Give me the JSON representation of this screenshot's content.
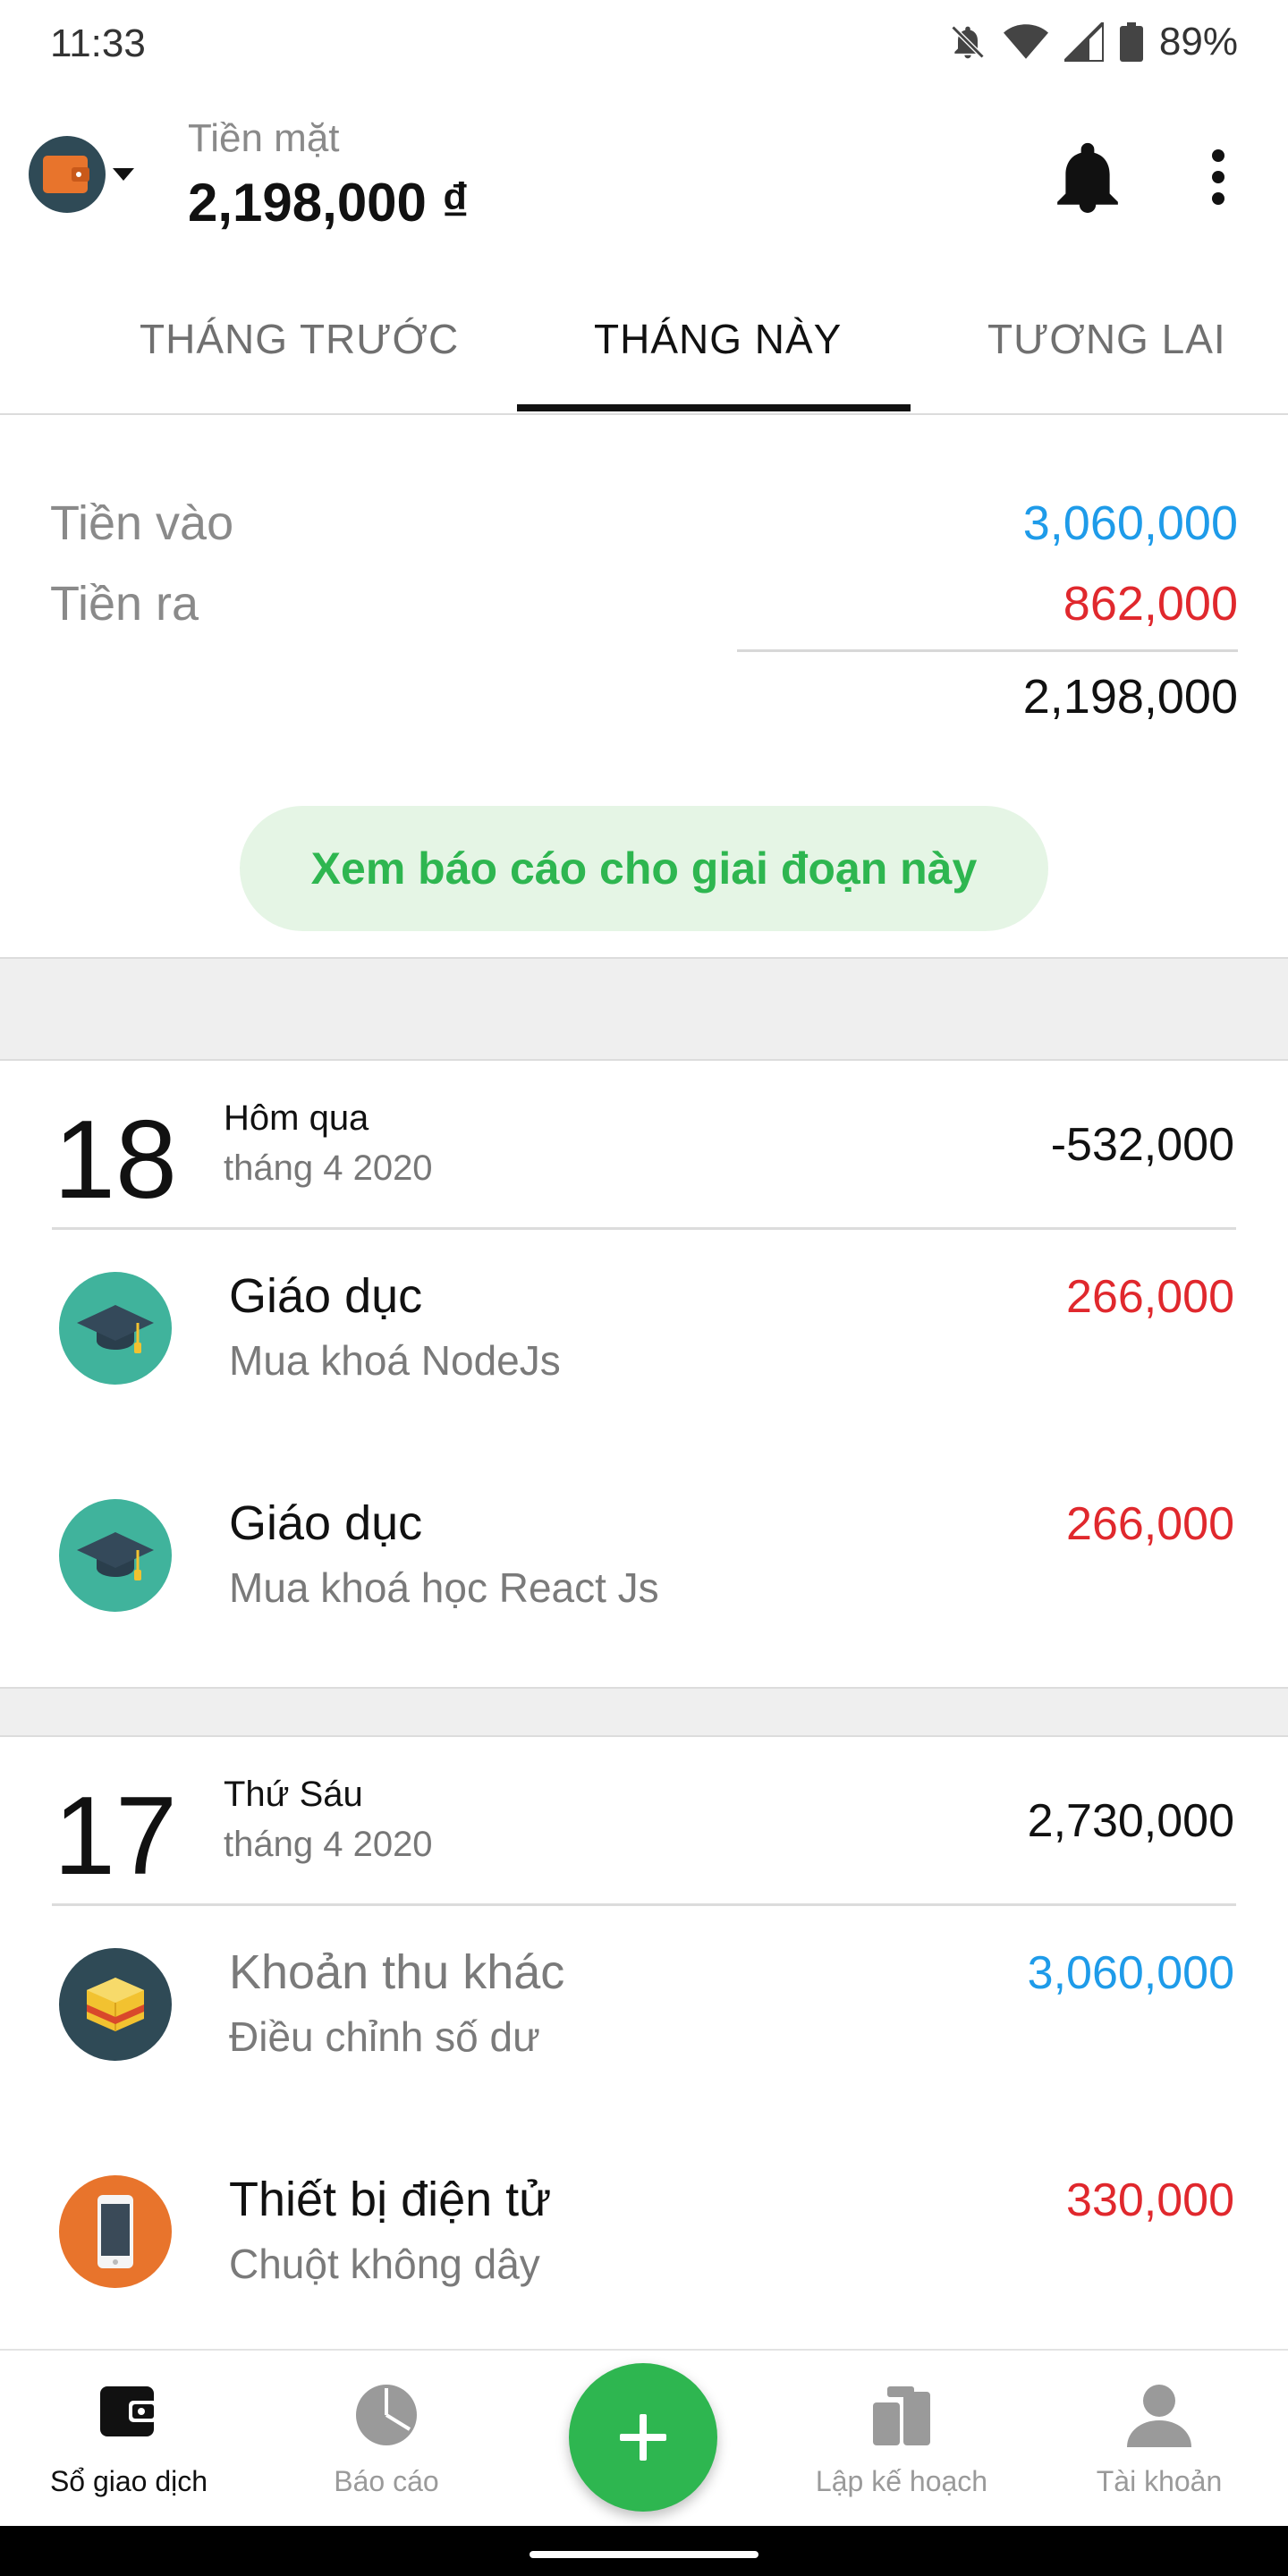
{
  "status_bar": {
    "time": "11:33",
    "battery": "89%"
  },
  "header": {
    "wallet_name": "Tiền mặt",
    "balance": "2,198,000 ₫"
  },
  "tabs": [
    {
      "label": "THÁNG TRƯỚC"
    },
    {
      "label": "THÁNG NÀY",
      "selected": true
    },
    {
      "label": "TƯƠNG LAI"
    }
  ],
  "summary": {
    "inflow_label": "Tiền vào",
    "inflow_value": "3,060,000",
    "outflow_label": "Tiền ra",
    "outflow_value": "862,000",
    "total": "2,198,000",
    "report_button": "Xem báo cáo cho giai đoạn này"
  },
  "groups": [
    {
      "day": "18",
      "day_name": "Hôm qua",
      "month": "tháng 4 2020",
      "total": "-532,000",
      "transactions": [
        {
          "category": "Giáo dục",
          "note": "Mua khoá NodeJs",
          "amount": "266,000",
          "icon": "graduation-cap-icon"
        },
        {
          "category": "Giáo dục",
          "note": "Mua khoá học React Js",
          "amount": "266,000",
          "icon": "graduation-cap-icon"
        }
      ]
    },
    {
      "day": "17",
      "day_name": "Thứ Sáu",
      "month": "tháng 4 2020",
      "total": "2,730,000",
      "transactions": [
        {
          "category": "Khoản thu khác",
          "note": "Điều chỉnh số dư",
          "amount": "3,060,000",
          "icon": "box-icon"
        },
        {
          "category": "Thiết bị điện tử",
          "note": "Chuột không dây",
          "amount": "330,000",
          "icon": "smartphone-icon"
        }
      ]
    }
  ],
  "bottom_nav": {
    "ledger": "Sổ giao dịch",
    "report": "Báo cáo",
    "planning": "Lập kế hoạch",
    "account": "Tài khoản"
  },
  "colors": {
    "accent_green": "#2eb650",
    "inflow_blue": "#1e9be9",
    "outflow_red": "#e0282d"
  }
}
